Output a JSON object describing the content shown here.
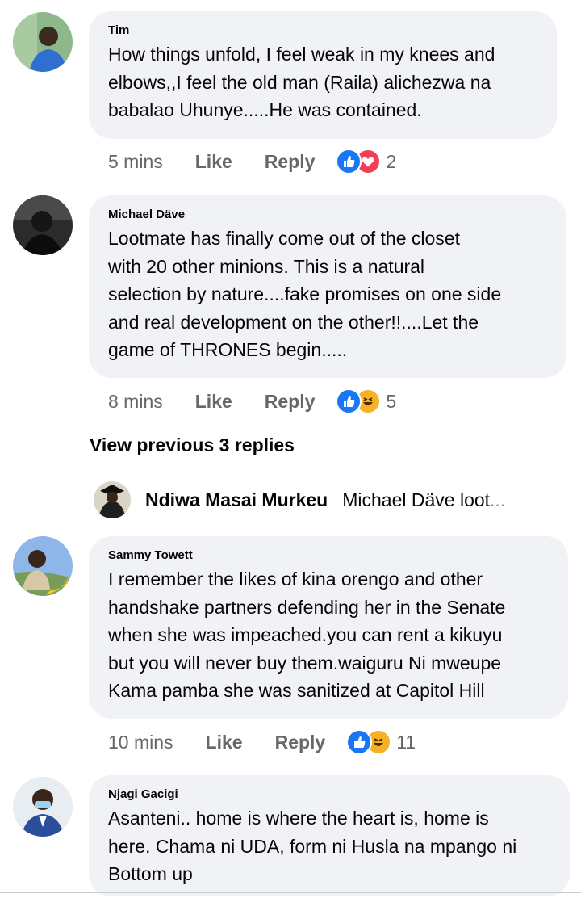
{
  "colors": {
    "bubble": "#f0f2f5",
    "meta": "#65676b",
    "like_blue": "#1877f2",
    "love_red": "#f33e58",
    "haha_yellow": "#f7b125"
  },
  "comments": [
    {
      "author": "Tim",
      "lines": [
        "How things unfold, I feel weak in my knees and",
        "elbows,,I feel the old man (Raila) alichezwa na",
        "babalao Uhunye.....He was contained."
      ],
      "time": "5 mins",
      "like_label": "Like",
      "reply_label": "Reply",
      "reactions": [
        "like-icon",
        "love-icon"
      ],
      "reaction_count": "2"
    },
    {
      "author": "Michael Däve",
      "lines": [
        "Lootmate has finally come out of the closet",
        "with 20 other minions. This is a natural",
        "selection by nature....fake promises on one side",
        "and real development on the other!!....Let the",
        "game of THRONES begin....."
      ],
      "time": "8 mins",
      "like_label": "Like",
      "reply_label": "Reply",
      "reactions": [
        "like-icon",
        "haha-icon"
      ],
      "reaction_count": "5"
    },
    {
      "author": "Sammy Towett",
      "lines": [
        "I remember the likes of kina orengo and other",
        "handshake partners defending her in the Senate",
        "when she was impeached.you can rent a kikuyu",
        "but you will never buy them.waiguru Ni mweupe",
        "Kama pamba she was sanitized at Capitol Hill"
      ],
      "time": "10 mins",
      "like_label": "Like",
      "reply_label": "Reply",
      "reactions": [
        "like-icon",
        "haha-icon"
      ],
      "reaction_count": "11"
    },
    {
      "author": "Njagi Gacigi",
      "lines": [
        "Asanteni.. home is where the heart is, home is",
        "here. Chama ni UDA, form ni Husla na mpango ni",
        "Bottom up"
      ]
    }
  ],
  "view_previous": "View previous 3 replies",
  "reply_preview": {
    "author": "Ndiwa Masai Murkeu",
    "text": "Michael Däve  loot",
    "ellipsis": "..."
  }
}
